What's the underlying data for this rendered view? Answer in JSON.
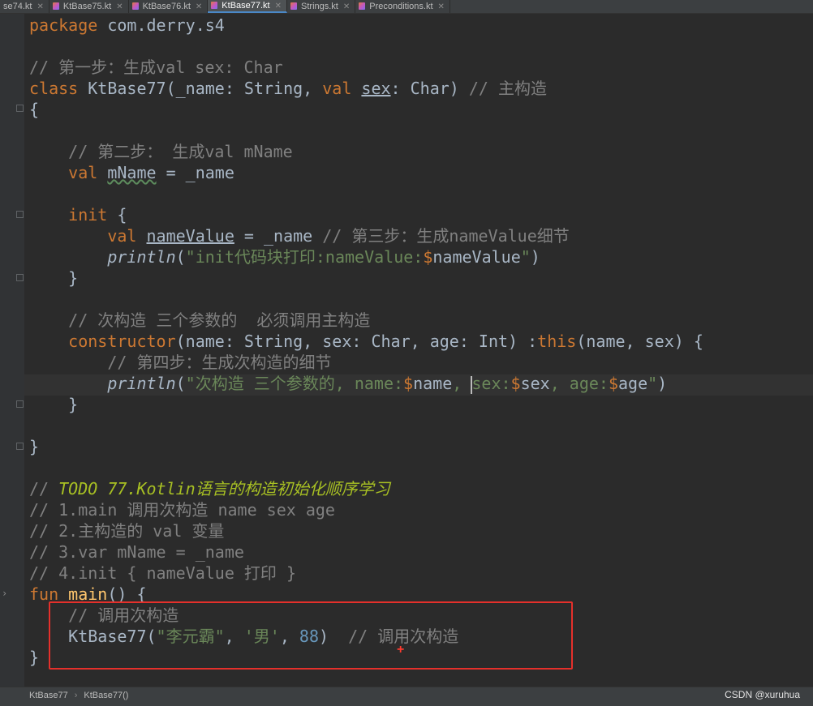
{
  "tabs": [
    {
      "label": "se74.kt",
      "active": false
    },
    {
      "label": "KtBase75.kt",
      "active": false
    },
    {
      "label": "KtBase76.kt",
      "active": false
    },
    {
      "label": "KtBase77.kt",
      "active": true
    },
    {
      "label": "Strings.kt",
      "active": false
    },
    {
      "label": "Preconditions.kt",
      "active": false
    }
  ],
  "code": {
    "l01_pkg_kw": "package",
    "l01_pkg_name": " com.derry.s4",
    "l03_comment": "// 第一步：生成val sex: Char",
    "l04_class_kw": "class",
    "l04_name": " KtBase77(_name: String, ",
    "l04_val": "val",
    "l04_sex": "sex",
    "l04_rest": ": Char) ",
    "l04_comment": "// 主构造",
    "l05_brace": "{",
    "l07_comment": "    // 第二步： 生成val mName",
    "l08_val": "    val",
    "l08_mname": "mName",
    "l08_rest": " = _name",
    "l10_init": "    init",
    "l10_rest": " {",
    "l11_val": "        val",
    "l11_namevalue": "nameValue",
    "l11_rest": " = _name ",
    "l11_comment": "// 第三步：生成nameValue细节",
    "l12_println": "        println",
    "l12_open": "(",
    "l12_str": "\"init代码块打印:nameValue:",
    "l12_dollar": "$",
    "l12_var": "nameValue",
    "l12_close_str": "\"",
    "l12_close": ")",
    "l13_brace": "    }",
    "l15_comment": "    // 次构造 三个参数的  必须调用主构造",
    "l16_ctor": "    constructor",
    "l16_params": "(name: String, sex: Char, age: Int) :",
    "l16_this": "this",
    "l16_rest": "(name, sex) {",
    "l17_comment": "        // 第四步：生成次构造的细节",
    "l18_println": "        println",
    "l18_open": "(",
    "l18_str1": "\"次构造 三个参数的, name:",
    "l18_d1": "$",
    "l18_v1": "name",
    "l18_str2": ", ",
    "l18_str3": "sex:",
    "l18_d2": "$",
    "l18_v2": "sex",
    "l18_str4": ", age:",
    "l18_d3": "$",
    "l18_v3": "age",
    "l18_str5": "\"",
    "l18_close": ")",
    "l19_brace": "    }",
    "l21_brace": "}",
    "l23_slash": "// ",
    "l23_todo": "TODO 77.Kotlin语言的构造初始化顺序学习",
    "l24_comment": "// 1.main 调用次构造 name sex age",
    "l25_comment": "// 2.主构造的 val 变量",
    "l26_comment": "// 3.var mName = _name",
    "l27_comment": "// 4.init { nameValue 打印 }",
    "l28_fun": "fun",
    "l28_main": " main",
    "l28_rest": "() {",
    "l29_comment": "    // 调用次构造",
    "l30_call": "    KtBase77(",
    "l30_s1": "\"李元霸\"",
    "l30_c1": ", ",
    "l30_s2": "'男'",
    "l30_c2": ", ",
    "l30_num": "88",
    "l30_close": ")  ",
    "l30_comment": "// 调用次构造",
    "l31_brace": "}"
  },
  "status": {
    "crumb1": "KtBase77",
    "crumb_sep": "›",
    "crumb2": "KtBase77()"
  },
  "watermark": "CSDN @xuruhua",
  "colors": {
    "keyword": "#cc7832",
    "comment": "#808080",
    "todo": "#a8c023",
    "string": "#6a8759",
    "number": "#6897bb",
    "function": "#ffc66d",
    "highlight_box": "#e5302b"
  }
}
